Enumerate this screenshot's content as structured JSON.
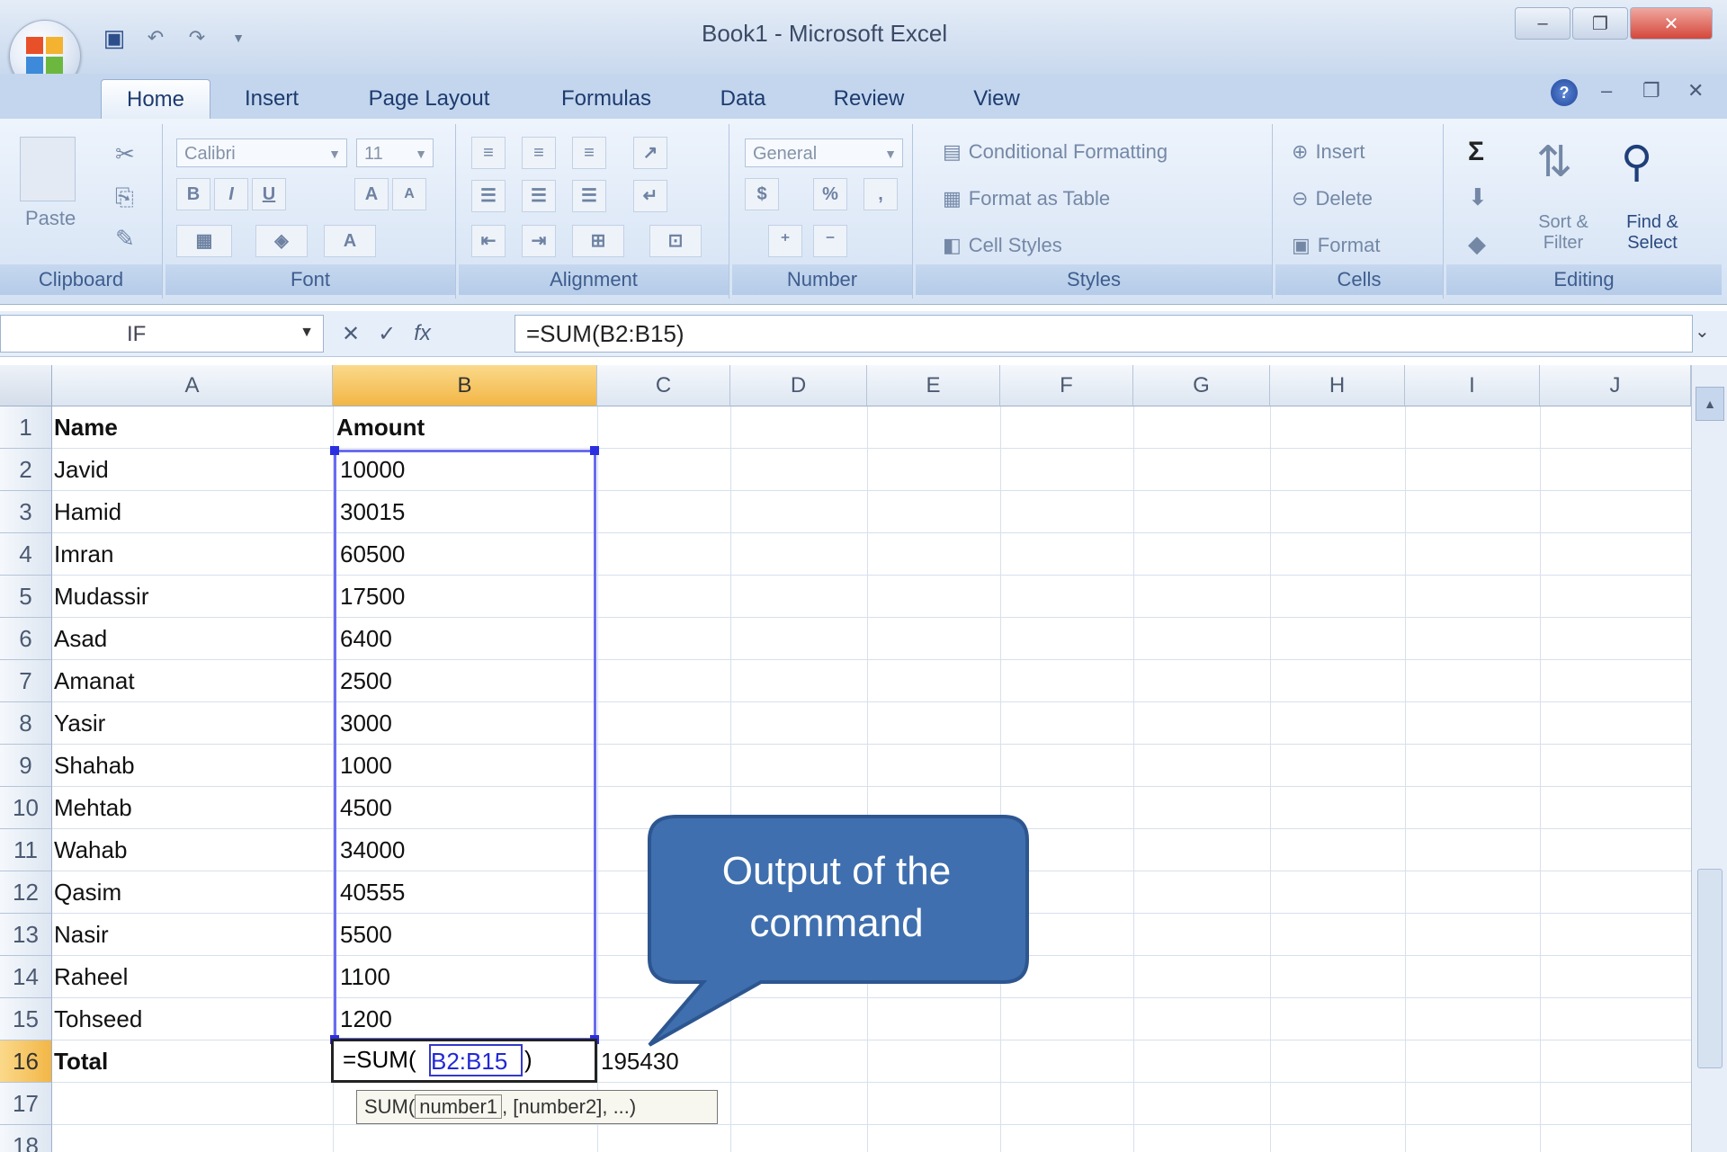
{
  "window": {
    "title": "Book1 - Microsoft Excel",
    "controls": [
      "–",
      "❐",
      "✕"
    ]
  },
  "tabs": [
    "Home",
    "Insert",
    "Page Layout",
    "Formulas",
    "Data",
    "Review",
    "View"
  ],
  "ribbon": {
    "clipboard": {
      "label": "Clipboard",
      "paste": "Paste"
    },
    "font": {
      "label": "Font",
      "font_name": "Calibri",
      "font_size": "11",
      "bold": "B",
      "italic": "I",
      "underline": "U"
    },
    "alignment": {
      "label": "Alignment"
    },
    "number": {
      "label": "Number",
      "format": "General",
      "currency": "$",
      "percent": "%",
      "comma": ","
    },
    "styles": {
      "label": "Styles",
      "conditional": "Conditional Formatting",
      "format_table": "Format as Table",
      "cell_styles": "Cell Styles"
    },
    "cells": {
      "label": "Cells",
      "insert": "Insert",
      "delete": "Delete",
      "format": "Format"
    },
    "editing": {
      "label": "Editing",
      "sum": "Σ",
      "sort_filter": "Sort & Filter",
      "find_select": "Find & Select"
    }
  },
  "formula_bar": {
    "name_box": "IF",
    "formula": "=SUM(B2:B15)"
  },
  "columns": [
    "A",
    "B",
    "C",
    "D",
    "E",
    "F",
    "G",
    "H",
    "I",
    "J"
  ],
  "rows": [
    "1",
    "2",
    "3",
    "4",
    "5",
    "6",
    "7",
    "8",
    "9",
    "10",
    "11",
    "12",
    "13",
    "14",
    "15",
    "16",
    "17",
    "18"
  ],
  "sheet": {
    "header_name": "Name",
    "header_amount": "Amount",
    "names": [
      "Javid",
      "Hamid",
      "Imran",
      "Mudassir",
      "Asad",
      "Amanat",
      "Yasir",
      "Shahab",
      "Mehtab",
      "Wahab",
      "Qasim",
      "Nasir",
      "Raheel",
      "Tohseed"
    ],
    "amounts": [
      "10000",
      "30015",
      "60500",
      "17500",
      "6400",
      "2500",
      "3000",
      "1000",
      "4500",
      "34000",
      "40555",
      "5500",
      "1100",
      "1200"
    ],
    "total_label": "Total",
    "editing_prefix": "=SUM(",
    "editing_ref": "B2:B15",
    "editing_suffix": ")",
    "result": "195430"
  },
  "tooltip": {
    "func": "SUM(",
    "arg1": "number1",
    "rest": ", [number2], ...)"
  },
  "callout": {
    "text_line1": "Output of the",
    "text_line2": "command"
  }
}
